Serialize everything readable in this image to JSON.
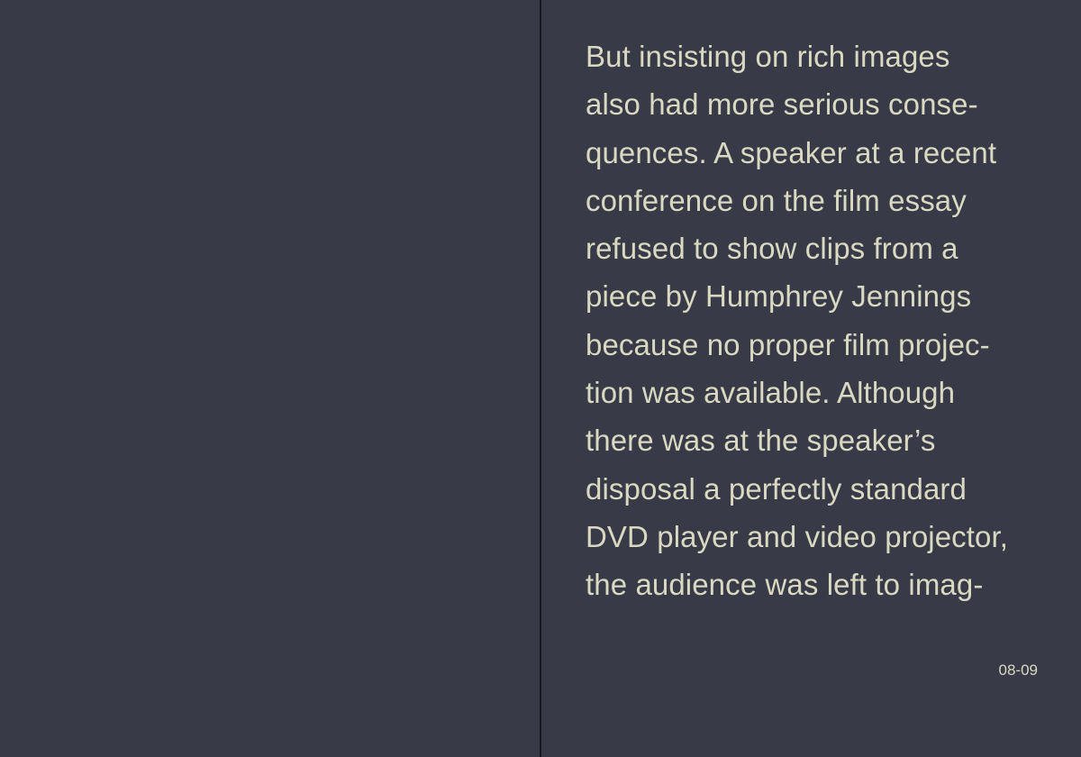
{
  "spread": {
    "colors": {
      "background": "#393a48",
      "gutter": "#17171d",
      "text": "#d9d9c2"
    },
    "right_page": {
      "lines": [
        "But insisting on rich images",
        "also had more serious conse-",
        "quences. A speaker at a recent",
        "conference on the film essay",
        "refused to show clips from a",
        "piece by Humphrey Jennings",
        "because no proper film projec-",
        "tion was available. Although",
        "there was at the speaker’s",
        "disposal a perfectly standard",
        "DVD player and video projector,",
        "the audience was left to imag-"
      ],
      "folio": "08-09"
    }
  }
}
